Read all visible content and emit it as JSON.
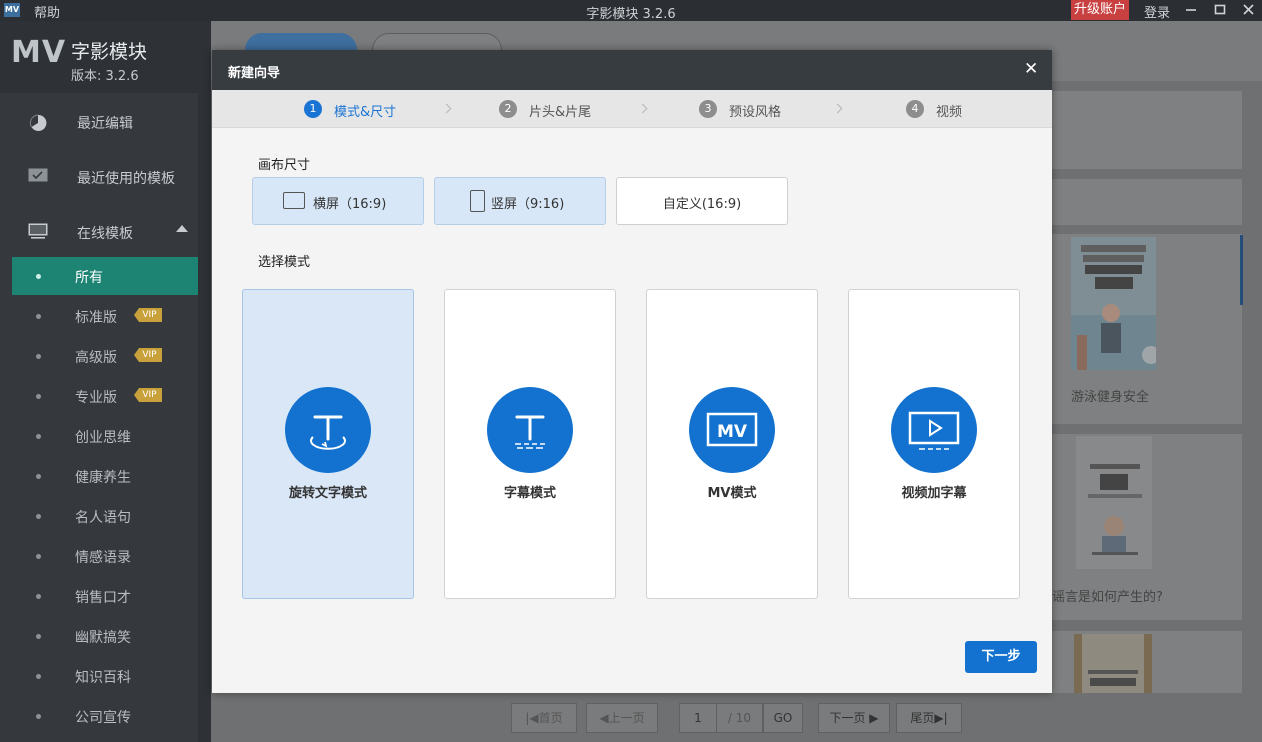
{
  "titlebar": {
    "logo": "MV",
    "help": "帮助",
    "title": "字影模块 3.2.6",
    "upgrade": "升级账户",
    "login": "登录",
    "minimize_icon": "minimize-icon",
    "maximize_icon": "maximize-icon",
    "close_icon": "close-icon"
  },
  "sidebar": {
    "brand_mark": "MV",
    "app_name": "字影模块",
    "version": "版本: 3.2.6",
    "nav": [
      {
        "label": "最近编辑",
        "icon": "clock-icon"
      },
      {
        "label": "最近使用的模板",
        "icon": "template-icon"
      },
      {
        "label": "在线模板",
        "icon": "monitor-icon"
      }
    ],
    "categories": [
      {
        "label": "所有",
        "vip": false,
        "active": true
      },
      {
        "label": "标准版",
        "vip": true
      },
      {
        "label": "高级版",
        "vip": true
      },
      {
        "label": "专业版",
        "vip": true
      },
      {
        "label": "创业思维",
        "vip": false
      },
      {
        "label": "健康养生",
        "vip": false
      },
      {
        "label": "名人语句",
        "vip": false
      },
      {
        "label": "情感语录",
        "vip": false
      },
      {
        "label": "销售口才",
        "vip": false
      },
      {
        "label": "幽默搞笑",
        "vip": false
      },
      {
        "label": "知识百科",
        "vip": false
      },
      {
        "label": "公司宣传",
        "vip": false
      }
    ],
    "vip_badge": "VIP"
  },
  "background": {
    "thumbnails": [
      {
        "caption": "游泳健身安全"
      },
      {
        "caption": "谣言是如何产生的?"
      }
    ],
    "pager": {
      "first": "|◀首页",
      "prev": "◀上一页",
      "current": "1",
      "total": "/ 10",
      "go": "GO",
      "next": "下一页 ▶",
      "last": "尾页▶|"
    }
  },
  "modal": {
    "title": "新建向导",
    "close": "✕",
    "steps": [
      {
        "num": "1",
        "label": "模式&尺寸",
        "active": true
      },
      {
        "num": "2",
        "label": "片头&片尾",
        "active": false
      },
      {
        "num": "3",
        "label": "预设风格",
        "active": false
      },
      {
        "num": "4",
        "label": "视频",
        "active": false
      }
    ],
    "canvas_title": "画布尺寸",
    "canvas_options": [
      {
        "label": "横屏（16:9)",
        "icon": "landscape-icon",
        "selected": true
      },
      {
        "label": "竖屏（9:16)",
        "icon": "portrait-icon",
        "selected": true
      },
      {
        "label": "自定义(16:9)",
        "icon": "",
        "selected": false
      }
    ],
    "mode_title": "选择模式",
    "modes": [
      {
        "label": "旋转文字模式",
        "icon": "rotate-text-icon",
        "selected": true
      },
      {
        "label": "字幕模式",
        "icon": "subtitle-icon",
        "selected": false
      },
      {
        "label": "MV模式",
        "icon": "mv-icon",
        "selected": false
      },
      {
        "label": "视频加字幕",
        "icon": "video-subtitle-icon",
        "selected": false
      }
    ],
    "next": "下一步"
  },
  "colors": {
    "accent": "#1372cf",
    "active_category": "#1d8474",
    "upgrade": "#c94040",
    "vip": "#c9a13a"
  }
}
